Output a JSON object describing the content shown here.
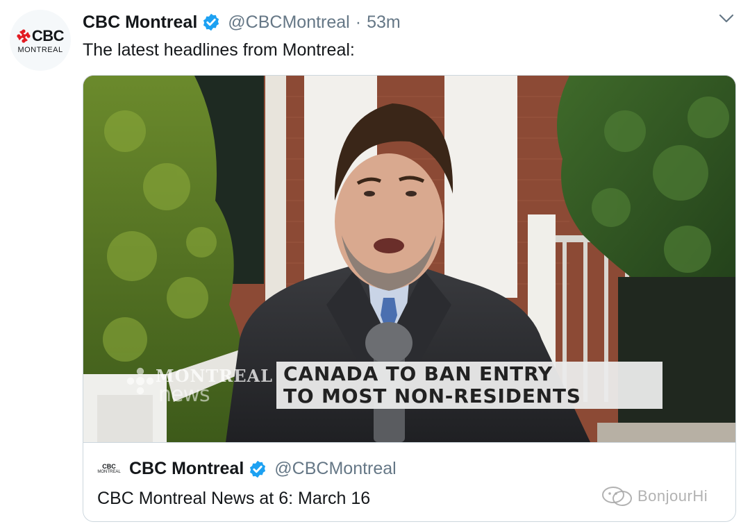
{
  "tweet": {
    "avatar": {
      "brand": "CBC",
      "city": "MONTREAL"
    },
    "display_name": "CBC Montreal",
    "handle": "@CBCMontreal",
    "separator": "·",
    "time": "53m",
    "text": "The latest headlines from Montreal:"
  },
  "card": {
    "media": {
      "headline_line1": "CANADA TO BAN ENTRY",
      "headline_line2": "TO MOST NON-RESIDENTS",
      "logo_top": "MONTREAL",
      "logo_bottom": "news"
    },
    "quoted": {
      "logo_top": "CBC",
      "logo_bottom": "MONTREAL",
      "name": "CBC Montreal",
      "handle": "@CBCMontreal",
      "text": "CBC Montreal News at 6: March 16"
    }
  },
  "watermark": {
    "text": "BonjourHi"
  },
  "colors": {
    "verified": "#1da1f2",
    "cbc_red": "#e21b22",
    "muted": "#657786"
  },
  "icons": [
    "cbc-gem-icon",
    "verified-badge-icon",
    "chevron-down-icon",
    "wechat-icon"
  ]
}
